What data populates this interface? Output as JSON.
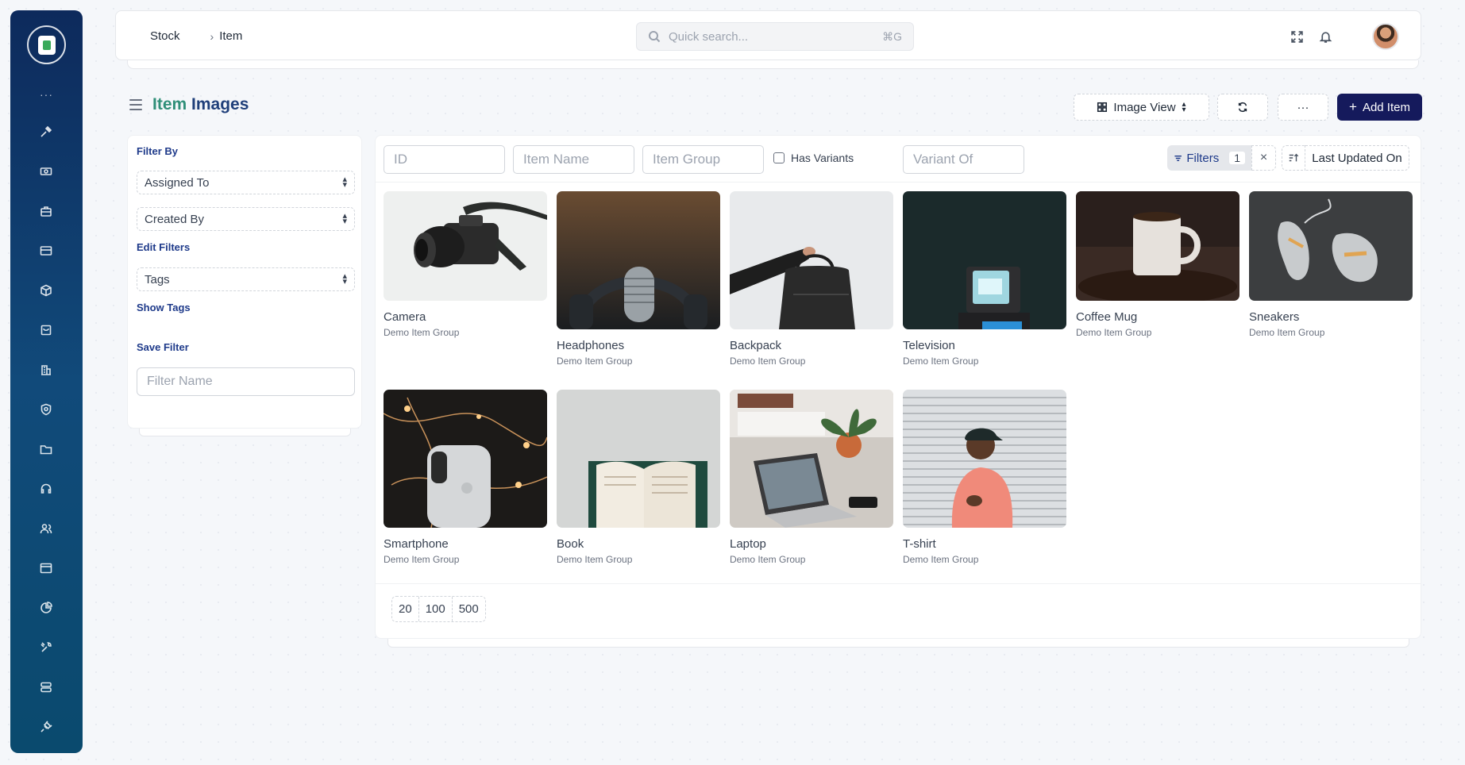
{
  "breadcrumb": {
    "root": "Stock",
    "current": "Item"
  },
  "search": {
    "placeholder": "Quick search...",
    "shortcut": "⌘G"
  },
  "page": {
    "title_accent": "Item",
    "title_rest": "Images"
  },
  "toolbar": {
    "view_label": "Image View",
    "more_label": "···",
    "add_label": "Add Item"
  },
  "sidebar_filters": {
    "heading": "Filter By",
    "assigned_to": "Assigned To",
    "created_by": "Created By",
    "edit_filters": "Edit Filters",
    "tags": "Tags",
    "show_tags": "Show Tags",
    "save_filter": "Save Filter",
    "filter_name_placeholder": "Filter Name"
  },
  "list_filters": {
    "id": "ID",
    "item_name": "Item Name",
    "item_group": "Item Group",
    "has_variants": "Has Variants",
    "variant_of": "Variant Of",
    "filters_label": "Filters",
    "filters_count": "1",
    "clear": "×",
    "sort_label": "Last Updated On"
  },
  "items": [
    {
      "name": "Camera",
      "group": "Demo Item Group",
      "icon": "camera"
    },
    {
      "name": "Headphones",
      "group": "Demo Item Group",
      "icon": "headphones"
    },
    {
      "name": "Backpack",
      "group": "Demo Item Group",
      "icon": "backpack"
    },
    {
      "name": "Television",
      "group": "Demo Item Group",
      "icon": "television"
    },
    {
      "name": "Coffee Mug",
      "group": "Demo Item Group",
      "icon": "mug"
    },
    {
      "name": "Sneakers",
      "group": "Demo Item Group",
      "icon": "sneakers"
    },
    {
      "name": "Smartphone",
      "group": "Demo Item Group",
      "icon": "smartphone"
    },
    {
      "name": "Book",
      "group": "Demo Item Group",
      "icon": "book"
    },
    {
      "name": "Laptop",
      "group": "Demo Item Group",
      "icon": "laptop"
    },
    {
      "name": "T-shirt",
      "group": "Demo Item Group",
      "icon": "tshirt"
    }
  ],
  "paging": [
    "20",
    "100",
    "500"
  ],
  "colors": {
    "sidebar": "#0d2a5c",
    "primary_button": "#151a5c",
    "title_accent": "#2f8f78",
    "title": "#1f3f7a"
  }
}
